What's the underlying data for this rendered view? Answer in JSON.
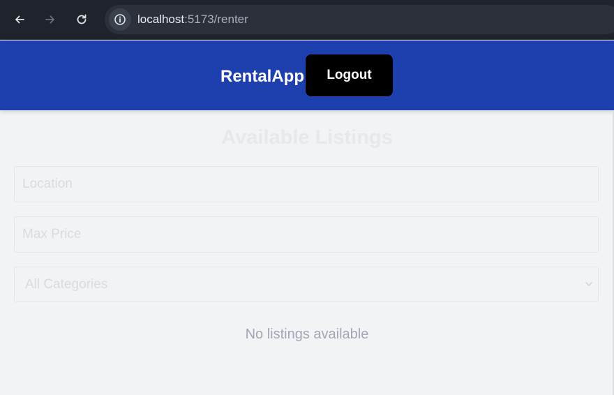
{
  "browser": {
    "url_host": "localhost",
    "url_rest": ":5173/renter",
    "back_icon": "arrow-left-icon",
    "forward_icon": "arrow-right-icon",
    "reload_icon": "reload-icon",
    "info_icon": "info-icon"
  },
  "header": {
    "brand": "RentalApp",
    "logout_label": "Logout",
    "bg_color": "#1e40af"
  },
  "main": {
    "title": "Available Listings",
    "location_placeholder": "Location",
    "max_price_placeholder": "Max Price",
    "category_selected": "All Categories",
    "empty_message": "No listings available"
  }
}
